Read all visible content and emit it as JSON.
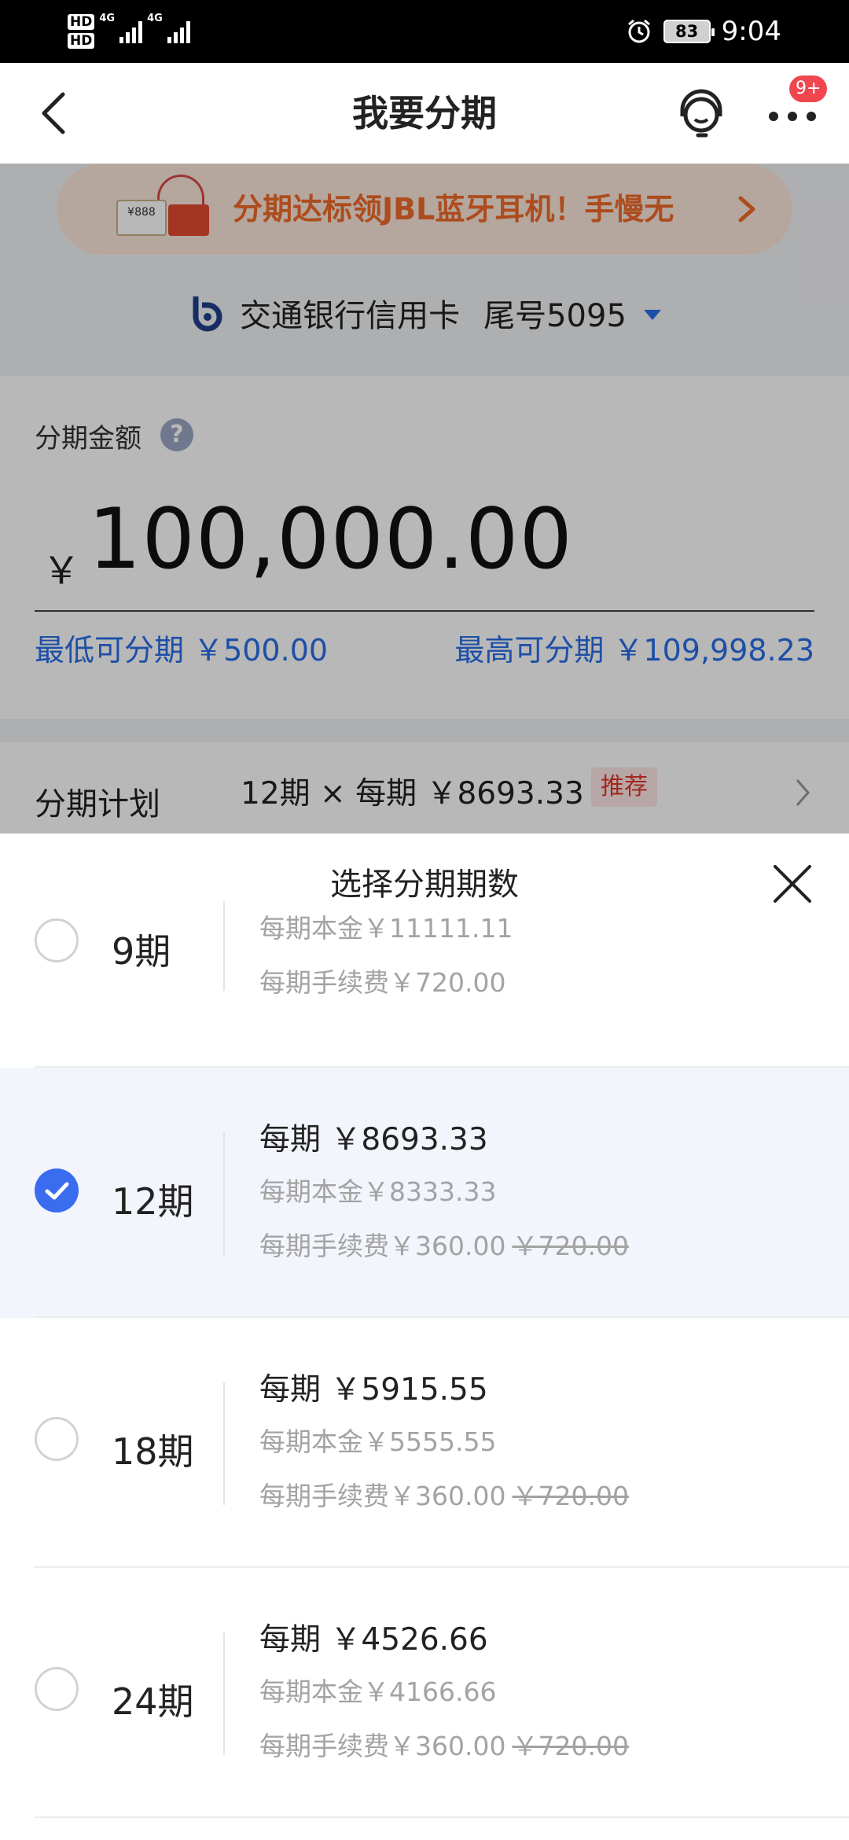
{
  "status_bar": {
    "hd1": "HD",
    "hd2": "HD",
    "net1": "4G",
    "net2": "4G",
    "battery": "83",
    "time": "9:04"
  },
  "header": {
    "title": "我要分期",
    "badge": "9+",
    "icons": [
      "back-arrow-icon",
      "customer-service-icon",
      "more-icon"
    ]
  },
  "promo": {
    "gift_label": "¥888",
    "text": "分期达标领JBL蓝牙耳机！手慢无"
  },
  "card": {
    "name": "交通银行信用卡",
    "tail": "尾号5095"
  },
  "amount": {
    "label": "分期金额",
    "help": "?",
    "currency": "￥",
    "value": "100,000.00",
    "min": "最低可分期 ￥500.00",
    "max": "最高可分期 ￥109,998.23"
  },
  "plan": {
    "label": "分期计划",
    "value": "12期 × 每期 ￥8693.33",
    "tag": "推荐"
  },
  "sheet": {
    "title": "选择分期期数",
    "options": [
      {
        "period": "9期",
        "selected": false,
        "per": "",
        "principal": "每期本金￥11111.11",
        "fee": "每期手续费￥720.00",
        "fee_original": ""
      },
      {
        "period": "12期",
        "selected": true,
        "per": "每期 ￥8693.33",
        "principal": "每期本金￥8333.33",
        "fee": "每期手续费￥360.00",
        "fee_original": "￥720.00"
      },
      {
        "period": "18期",
        "selected": false,
        "per": "每期 ￥5915.55",
        "principal": "每期本金￥5555.55",
        "fee": "每期手续费￥360.00",
        "fee_original": "￥720.00"
      },
      {
        "period": "24期",
        "selected": false,
        "per": "每期 ￥4526.66",
        "principal": "每期本金￥4166.66",
        "fee": "每期手续费￥360.00",
        "fee_original": "￥720.00"
      }
    ]
  },
  "colors": {
    "accent": "#2a6ee8",
    "radio_selected": "#3a6cf0",
    "promo_text": "#f06a2a",
    "badge": "#f04650",
    "tag": "#e2372b"
  }
}
